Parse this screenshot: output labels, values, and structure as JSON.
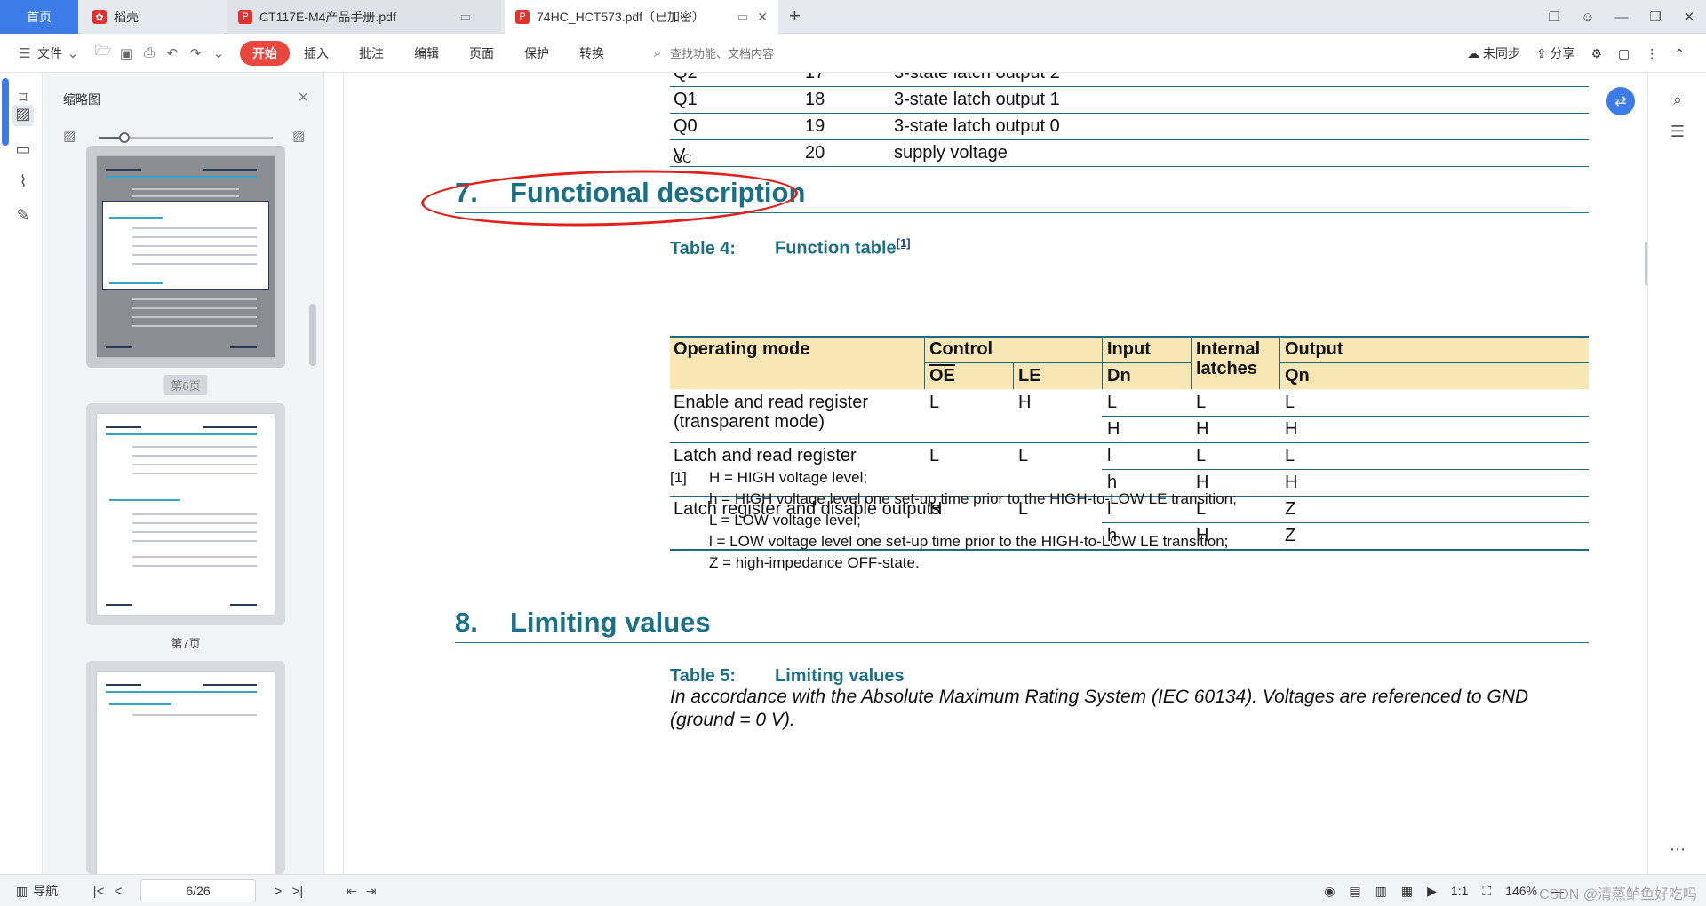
{
  "tabs": [
    {
      "label": "首页"
    },
    {
      "label": "稻壳",
      "icon": "daoke-logo-icon"
    },
    {
      "label": "CT117E-M4产品手册.pdf",
      "icon": "pdf-icon"
    },
    {
      "label": "74HC_HCT573.pdf（已加密）",
      "icon": "pdf-icon"
    }
  ],
  "toolbar": {
    "file_menu": "文件",
    "start": "开始",
    "menu_tabs": [
      "插入",
      "批注",
      "编辑",
      "页面",
      "保护",
      "转换"
    ],
    "search_placeholder": "查找功能、文档内容",
    "sync": "未同步",
    "share": "分享"
  },
  "thumbnails": {
    "title": "缩略图",
    "zoom_level": 0.15,
    "pages": [
      {
        "label": "第6页",
        "selected": true
      },
      {
        "label": "第7页",
        "selected": false
      }
    ]
  },
  "document": {
    "pin_rows": [
      {
        "name": "Q2",
        "pin": "17",
        "desc": "3-state latch output 2"
      },
      {
        "name": "Q1",
        "pin": "18",
        "desc": "3-state latch output 1"
      },
      {
        "name": "Q0",
        "pin": "19",
        "desc": "3-state latch output 0"
      },
      {
        "name": "V",
        "name_sub": "CC",
        "pin": "20",
        "desc": "supply voltage"
      }
    ],
    "section7": {
      "num": "7.",
      "title": "Functional description"
    },
    "table4": {
      "label": "Table 4:",
      "title": "Function table",
      "ref": "[1]",
      "headers": {
        "mode": "Operating mode",
        "control": "Control",
        "oe": "OE",
        "le": "LE",
        "input": "Input",
        "dn": "Dn",
        "internal": "Internal latches",
        "output": "Output",
        "qn": "Qn"
      },
      "rows": [
        {
          "mode": "Enable and read register (transparent mode)",
          "oe": "L",
          "le": "H",
          "dn": [
            "L",
            "H"
          ],
          "internal": [
            "L",
            "H"
          ],
          "qn": [
            "L",
            "H"
          ]
        },
        {
          "mode": "Latch and read register",
          "oe": "L",
          "le": "L",
          "dn": [
            "l",
            "h"
          ],
          "internal": [
            "L",
            "H"
          ],
          "qn": [
            "L",
            "H"
          ]
        },
        {
          "mode": "Latch register and disable outputs",
          "oe": "H",
          "le": "L",
          "dn": [
            "l",
            "h"
          ],
          "internal": [
            "L",
            "H"
          ],
          "qn": [
            "Z",
            "Z"
          ]
        }
      ]
    },
    "footnote_marker": "[1]",
    "footnotes": [
      "H = HIGH voltage level;",
      "h = HIGH voltage level one set-up time prior to the HIGH-to-LOW LE transition;",
      "L = LOW voltage level;",
      "l = LOW voltage level one set-up time prior to the HIGH-to-LOW LE transition;",
      "Z = high-impedance OFF-state."
    ],
    "section8": {
      "num": "8.",
      "title": "Limiting values"
    },
    "table5": {
      "label": "Table 5:",
      "title": "Limiting values",
      "note": "In accordance with the Absolute Maximum Rating System (IEC 60134). Voltages are referenced to GND (ground = 0 V)."
    }
  },
  "statusbar": {
    "nav": "导航",
    "page": "6/26",
    "zoom": "146%",
    "watermark": "CSDN @清蒸鲈鱼好吃吗"
  },
  "colors": {
    "accent": "#3d7ce8",
    "start_button": "#e9473d",
    "heading": "#1b6f86",
    "table_header": "#f8e7b4",
    "annotation": "#e0221d"
  }
}
